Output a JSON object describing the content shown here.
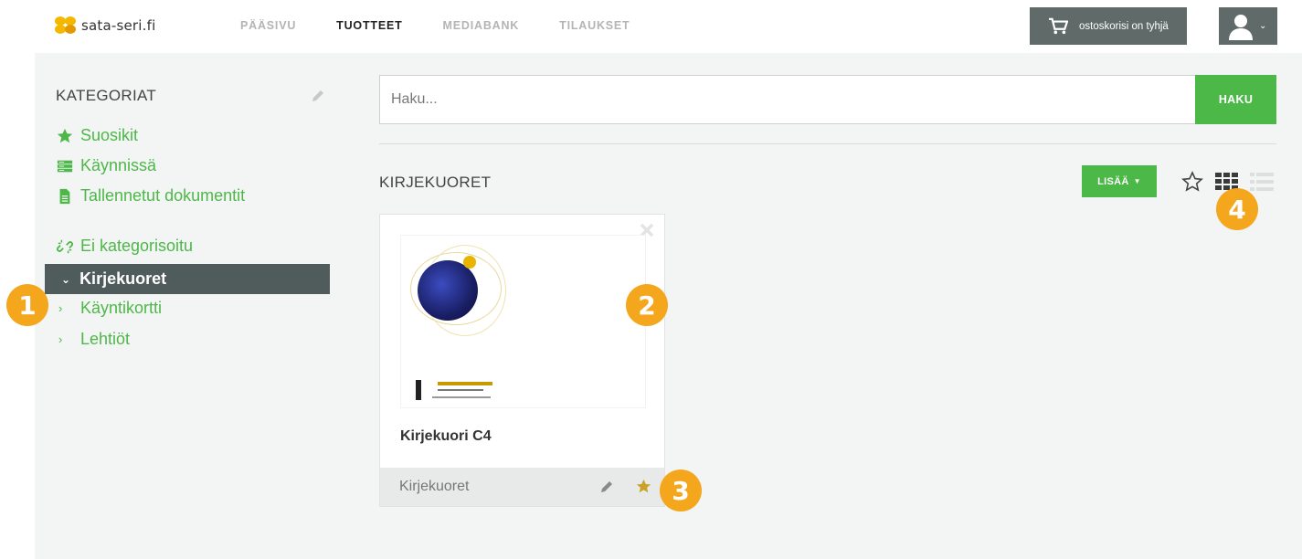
{
  "header": {
    "logo_text": "sata-seri.fi",
    "nav": [
      {
        "label": "PÄÄSIVU",
        "active": false
      },
      {
        "label": "TUOTTEET",
        "active": true
      },
      {
        "label": "MEDIABANK",
        "active": false
      },
      {
        "label": "TILAUKSET",
        "active": false
      }
    ],
    "cart_label": "ostoskorisi on tyhjä"
  },
  "sidebar": {
    "title": "KATEGORIAT",
    "links": [
      {
        "label": "Suosikit",
        "icon": "star-icon"
      },
      {
        "label": "Käynnissä",
        "icon": "stack-icon"
      },
      {
        "label": "Tallennetut dokumentit",
        "icon": "document-icon"
      }
    ],
    "uncategorized": {
      "label": "Ei kategorisoitu",
      "icon": "unlink-icon"
    },
    "categories": [
      {
        "label": "Kirjekuoret",
        "active": true
      },
      {
        "label": "Käyntikortti",
        "active": false
      },
      {
        "label": "Lehtiöt",
        "active": false
      }
    ]
  },
  "main": {
    "search": {
      "placeholder": "Haku...",
      "button_label": "HAKU"
    },
    "section_title": "KIRJEKUORET",
    "add_label": "LISÄÄ",
    "products": [
      {
        "title": "Kirjekuori C4",
        "category": "Kirjekuoret",
        "favorite": true
      }
    ]
  },
  "callouts": [
    "1",
    "2",
    "3",
    "4"
  ],
  "colors": {
    "accent_green": "#4cb848",
    "dark_gray": "#5f6a69",
    "active_row": "#505c5b",
    "callout_orange": "#f4a61c",
    "favorite_gold": "#c9a227"
  }
}
